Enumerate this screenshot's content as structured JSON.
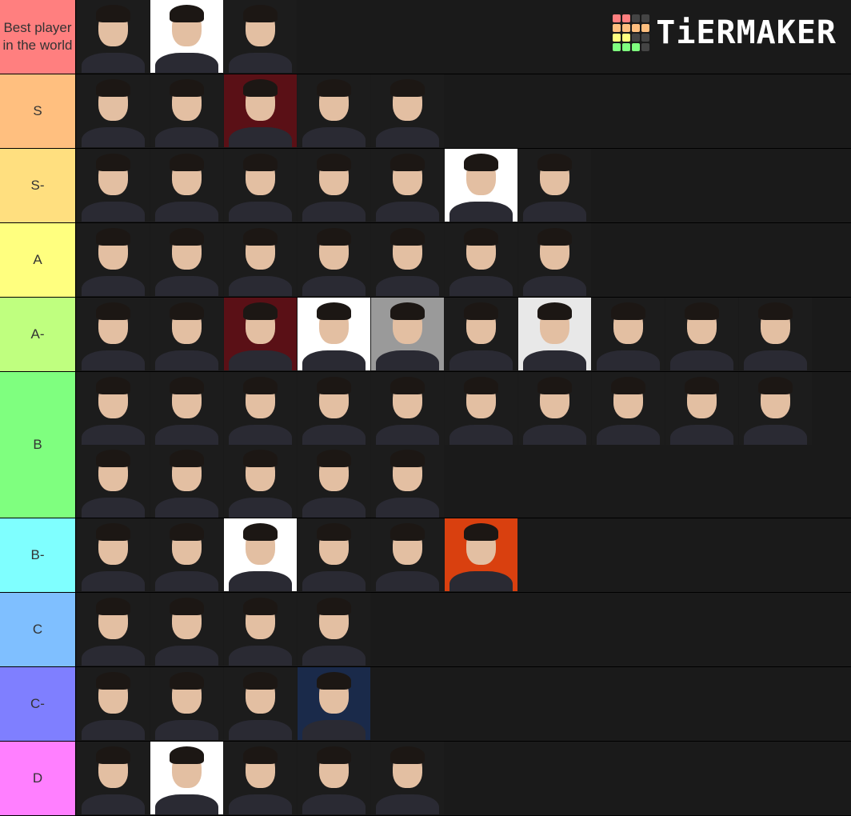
{
  "logo": {
    "text": "TiERMAKER",
    "grid": [
      "#ff7f7f",
      "#ff7f7f",
      "#444",
      "#444",
      "#ffbf7f",
      "#ffbf7f",
      "#ffbf7f",
      "#ffbf7f",
      "#ffff7f",
      "#ffff7f",
      "#444",
      "#444",
      "#7fff7f",
      "#7fff7f",
      "#7fff7f",
      "#444"
    ]
  },
  "tiers": [
    {
      "label": "Best player in the world",
      "color": "#ff7f7f",
      "items": [
        "#1c1c1c",
        "#ffffff",
        "#1c1c1c"
      ]
    },
    {
      "label": "S",
      "color": "#ffbf7f",
      "items": [
        "#1c1c1c",
        "#1c1c1c",
        "#5a1016",
        "#1c1c1c",
        "#1c1c1c"
      ]
    },
    {
      "label": "S-",
      "color": "#ffdf7f",
      "items": [
        "#1c1c1c",
        "#1c1c1c",
        "#1c1c1c",
        "#1c1c1c",
        "#1c1c1c",
        "#ffffff",
        "#1c1c1c"
      ]
    },
    {
      "label": "A",
      "color": "#ffff7f",
      "items": [
        "#1c1c1c",
        "#1c1c1c",
        "#1c1c1c",
        "#1c1c1c",
        "#1c1c1c",
        "#1c1c1c",
        "#1c1c1c"
      ]
    },
    {
      "label": "A-",
      "color": "#bfff7f",
      "items": [
        "#1c1c1c",
        "#1c1c1c",
        "#5a1016",
        "#ffffff",
        "#9a9a9a",
        "#1c1c1c",
        "#e8e8e8",
        "#1c1c1c",
        "#1c1c1c",
        "#1c1c1c"
      ]
    },
    {
      "label": "B",
      "color": "#7fff7f",
      "items": [
        "#1c1c1c",
        "#1c1c1c",
        "#1c1c1c",
        "#1c1c1c",
        "#1c1c1c",
        "#1c1c1c",
        "#1c1c1c",
        "#1c1c1c",
        "#1c1c1c",
        "#1c1c1c",
        "#1c1c1c",
        "#1c1c1c",
        "#1c1c1c",
        "#1c1c1c",
        "#1c1c1c"
      ]
    },
    {
      "label": "B-",
      "color": "#7fffff",
      "items": [
        "#1c1c1c",
        "#1c1c1c",
        "#ffffff",
        "#1c1c1c",
        "#1c1c1c",
        "#d9400f"
      ]
    },
    {
      "label": "C",
      "color": "#7fbfff",
      "items": [
        "#1c1c1c",
        "#1c1c1c",
        "#1c1c1c",
        "#1c1c1c"
      ]
    },
    {
      "label": "C-",
      "color": "#7f7fff",
      "items": [
        "#1c1c1c",
        "#1c1c1c",
        "#1c1c1c",
        "#1a2a4a"
      ]
    },
    {
      "label": "D",
      "color": "#ff7fff",
      "items": [
        "#1c1c1c",
        "#ffffff",
        "#1c1c1c",
        "#1c1c1c",
        "#1c1c1c"
      ]
    }
  ]
}
